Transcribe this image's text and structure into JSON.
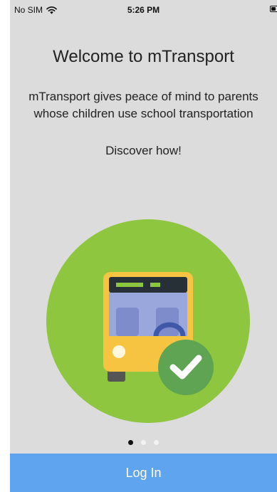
{
  "status_bar": {
    "carrier": "No SIM",
    "time": "5:26 PM"
  },
  "welcome": {
    "title": "Welcome to mTransport",
    "description_lines": [
      "mTransport gives peace of mind to parents",
      "whose children use school transportation"
    ],
    "cta": "Discover how!"
  },
  "illustration": {
    "icons": [
      "school-bus-icon",
      "checkmark-icon"
    ],
    "colors": {
      "circle": "#8ec63f",
      "bus": "#f7c441",
      "check_badge": "#5fa452"
    }
  },
  "pager": {
    "count": 3,
    "active_index": 0
  },
  "login": {
    "label": "Log In",
    "color": "#5ea4ef"
  }
}
